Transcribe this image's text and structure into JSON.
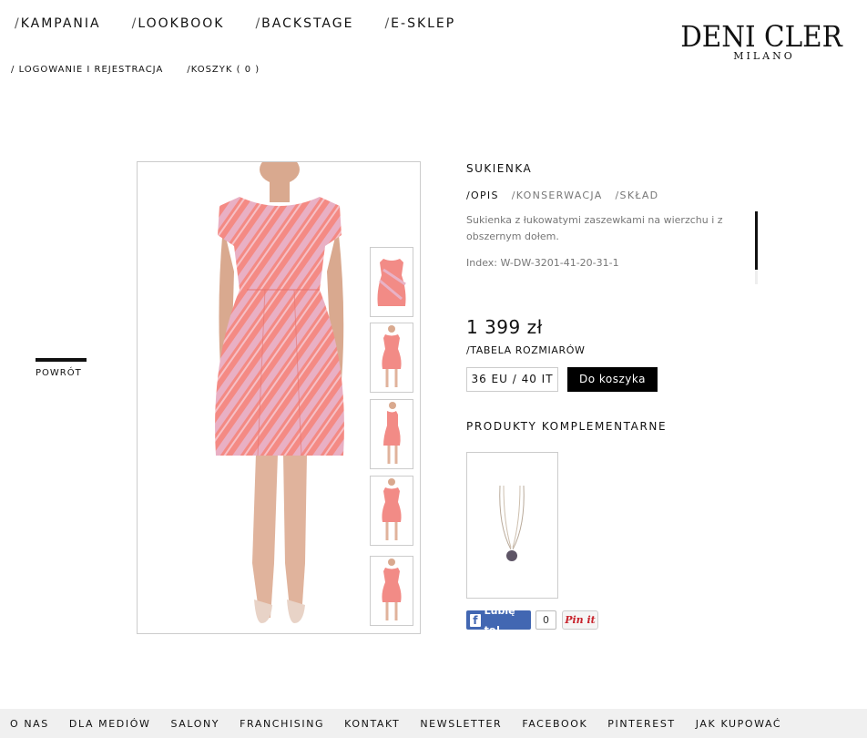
{
  "nav": {
    "main": [
      "KAMPANIA",
      "LOOKBOOK",
      "BACKSTAGE",
      "E-SKLEP"
    ],
    "sub": [
      "LOGOWANIE I REJESTRACJA",
      "KOSZYK ( 0 )"
    ]
  },
  "logo": {
    "brand": "DENI CLER",
    "city": "MILANO"
  },
  "back": {
    "label": "POWRÓT"
  },
  "product": {
    "title": "SUKIENKA",
    "tabs": [
      "/OPIS",
      "/KONSERWACJA",
      "/SKŁAD"
    ],
    "description": "Sukienka z łukowatymi zaszewkami na wierzchu i z obszernym dołem.",
    "index": "Index: W-DW-3201-41-20-31-1",
    "price": "1 399 zł",
    "size_table": "/TABELA ROZMIARÓW",
    "size": "36 EU / 40 IT",
    "cart_button": "Do koszyka"
  },
  "complementary": {
    "title": "PRODUKTY KOMPLEMENTARNE"
  },
  "social": {
    "fb_label": "Lubię to!",
    "fb_count": "0",
    "pin_label": "Pin it"
  },
  "footer": [
    "O NAS",
    "DLA MEDIÓW",
    "SALONY",
    "FRANCHISING",
    "KONTAKT",
    "NEWSLETTER",
    "FACEBOOK",
    "PINTEREST",
    "JAK KUPOWAĆ"
  ],
  "colors": {
    "accent": "#000000",
    "dress": "#f28b86",
    "facebook": "#4267b2",
    "pinterest": "#c8232c"
  }
}
